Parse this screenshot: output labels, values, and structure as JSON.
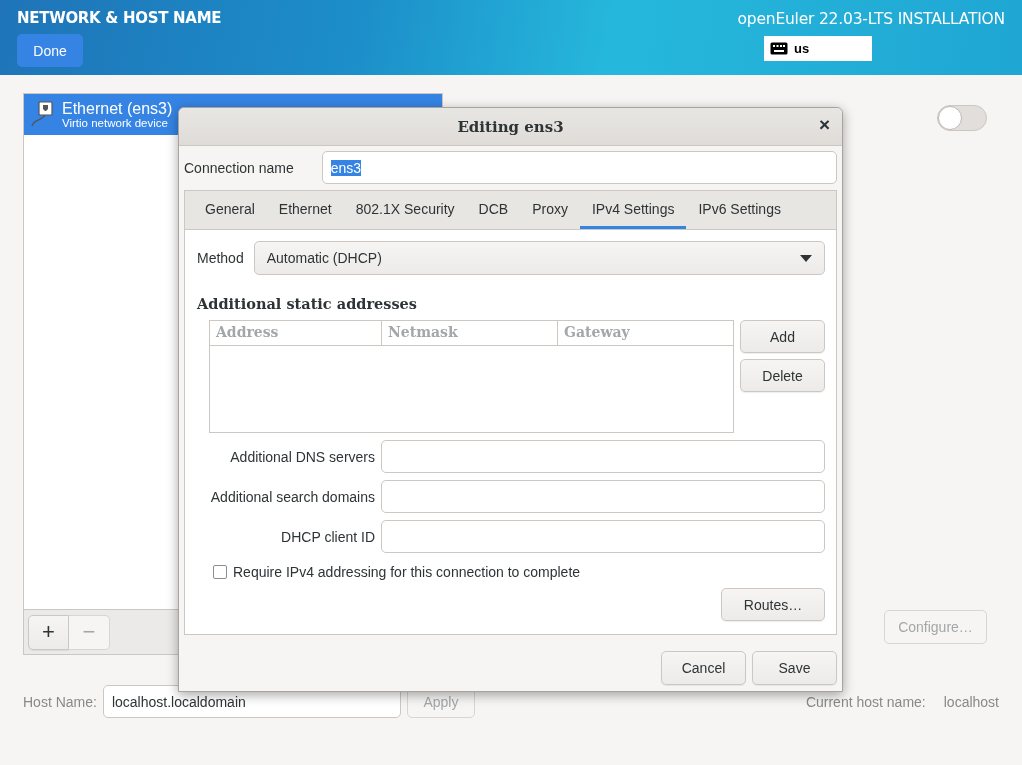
{
  "header": {
    "title": "NETWORK & HOST NAME",
    "done_button": "Done",
    "product": "openEuler 22.03-LTS INSTALLATION",
    "keyboard_layout": "us"
  },
  "devices": [
    {
      "name": "Ethernet (ens3)",
      "description": "Virtio network device",
      "selected": true
    }
  ],
  "device_toolbar": [
    {
      "label": "+",
      "disabled": false
    },
    {
      "label": "−",
      "disabled": true
    }
  ],
  "device_switch": {
    "on": false
  },
  "configure_button": {
    "label": "Configure…",
    "disabled": true
  },
  "host": {
    "label": "Host Name:",
    "value": "localhost.localdomain",
    "apply_button": {
      "label": "Apply",
      "disabled": true
    },
    "current_label": "Current host name:",
    "current_value": "localhost"
  },
  "dialog": {
    "title": "Editing ens3",
    "close": "×",
    "connection_label": "Connection name",
    "connection_value": "ens3",
    "connection_value_selected": true,
    "tabs": [
      {
        "label": "General",
        "selected": false
      },
      {
        "label": "Ethernet",
        "selected": false
      },
      {
        "label": "802.1X Security",
        "selected": false
      },
      {
        "label": "DCB",
        "selected": false
      },
      {
        "label": "Proxy",
        "selected": false
      },
      {
        "label": "IPv4 Settings",
        "selected": true
      },
      {
        "label": "IPv6 Settings",
        "selected": false
      }
    ],
    "method_label": "Method",
    "method_value": "Automatic (DHCP)",
    "section_title": "Additional static addresses",
    "table_columns": [
      "Address",
      "Netmask",
      "Gateway"
    ],
    "table_buttons": [
      "Add",
      "Delete"
    ],
    "fields": [
      {
        "label": "Additional DNS servers"
      },
      {
        "label": "Additional search domains"
      },
      {
        "label": "DHCP client ID"
      }
    ],
    "require_checkbox": {
      "label": "Require IPv4 addressing for this connection to complete",
      "checked": false
    },
    "routes_button": "Routes…",
    "footer_buttons": [
      "Cancel",
      "Save"
    ]
  }
}
